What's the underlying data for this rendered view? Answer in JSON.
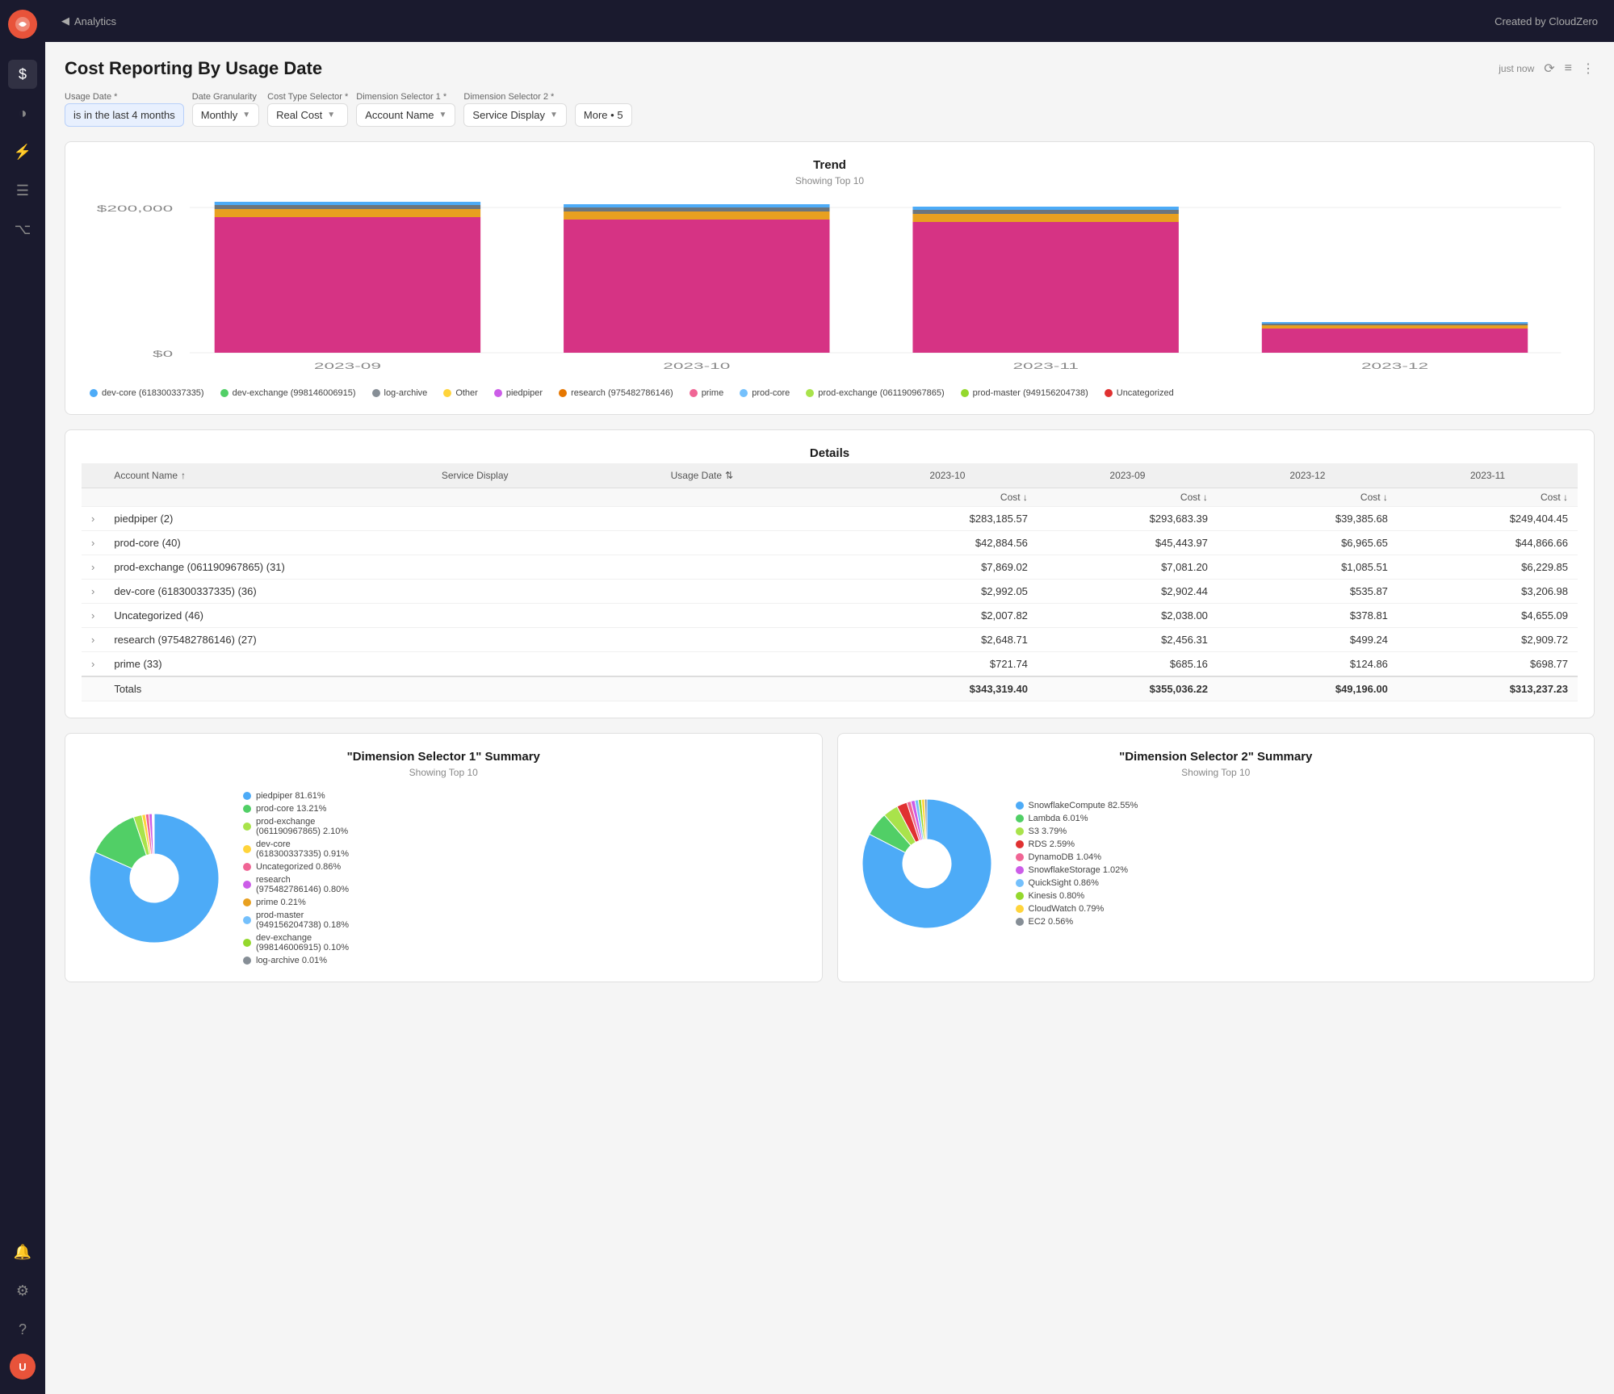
{
  "app": {
    "logo_text": "CZ",
    "nav_back": "◀",
    "nav_section": "Analytics",
    "created_by": "Created by CloudZero"
  },
  "sidebar": {
    "icons": [
      {
        "name": "dollar-icon",
        "symbol": "$",
        "active": true
      },
      {
        "name": "pie-chart-icon",
        "symbol": "◑",
        "active": false
      },
      {
        "name": "lightbulb-icon",
        "symbol": "💡",
        "active": false
      },
      {
        "name": "list-icon",
        "symbol": "≡",
        "active": false
      },
      {
        "name": "code-icon",
        "symbol": "⌥",
        "active": false
      },
      {
        "name": "bell-icon",
        "symbol": "🔔",
        "active": false
      },
      {
        "name": "gear-icon",
        "symbol": "⚙",
        "active": false
      },
      {
        "name": "help-icon",
        "symbol": "?",
        "active": false
      }
    ],
    "avatar_initials": "U"
  },
  "page": {
    "title": "Cost Reporting By Usage Date",
    "time_label": "just now",
    "filter_icon": "⟳",
    "menu_icon": "⋮"
  },
  "filters": {
    "usage_date_label": "Usage Date *",
    "usage_date_value": "is in the last 4 months",
    "granularity_label": "Date Granularity",
    "granularity_value": "Monthly",
    "cost_type_label": "Cost Type Selector *",
    "cost_type_value": "Real Cost",
    "dim1_label": "Dimension Selector 1 *",
    "dim1_value": "Account Name",
    "dim2_label": "Dimension Selector 2 *",
    "dim2_value": "Service Display",
    "more_label": "More • 5"
  },
  "trend": {
    "title": "Trend",
    "subtitle": "Showing Top 10",
    "y_labels": [
      "$200,000",
      "$0"
    ],
    "x_labels": [
      "2023-09",
      "2023-10",
      "2023-11",
      "2023-12"
    ],
    "bars": [
      {
        "period": "2023-09",
        "total_height": 95,
        "segments": [
          {
            "color": "#d63384",
            "pct": 88
          },
          {
            "color": "#e8a020",
            "pct": 6
          },
          {
            "color": "#6c757d",
            "pct": 3
          },
          {
            "color": "#adb5bd",
            "pct": 3
          }
        ]
      },
      {
        "period": "2023-10",
        "total_height": 92,
        "segments": [
          {
            "color": "#d63384",
            "pct": 88
          },
          {
            "color": "#e8a020",
            "pct": 6
          },
          {
            "color": "#6c757d",
            "pct": 3
          },
          {
            "color": "#adb5bd",
            "pct": 3
          }
        ]
      },
      {
        "period": "2023-11",
        "total_height": 90,
        "segments": [
          {
            "color": "#d63384",
            "pct": 88
          },
          {
            "color": "#e8a020",
            "pct": 6
          },
          {
            "color": "#6c757d",
            "pct": 3
          },
          {
            "color": "#adb5bd",
            "pct": 3
          }
        ]
      },
      {
        "period": "2023-12",
        "total_height": 20,
        "segments": [
          {
            "color": "#d63384",
            "pct": 70
          },
          {
            "color": "#e8a020",
            "pct": 15
          },
          {
            "color": "#6c757d",
            "pct": 10
          },
          {
            "color": "#adb5bd",
            "pct": 5
          }
        ]
      }
    ],
    "legend": [
      {
        "color": "#4dabf7",
        "label": "dev-core (618300337335)"
      },
      {
        "color": "#51cf66",
        "label": "dev-exchange (998146006915)"
      },
      {
        "color": "#868e96",
        "label": "log-archive"
      },
      {
        "color": "#ffd43b",
        "label": "Other"
      },
      {
        "color": "#cc5de8",
        "label": "piedpiper"
      },
      {
        "color": "#e67700",
        "label": "research (975482786146)"
      },
      {
        "color": "#f06595",
        "label": "prime"
      },
      {
        "color": "#74c0fc",
        "label": "prod-core"
      },
      {
        "color": "#a9e34b",
        "label": "prod-exchange (061190967865)"
      },
      {
        "color": "#94d82d",
        "label": "prod-master (949156204738)"
      },
      {
        "color": "#e03131",
        "label": "Uncategorized"
      }
    ]
  },
  "details": {
    "title": "Details",
    "columns": [
      {
        "label": "",
        "key": "expand"
      },
      {
        "label": "Account Name",
        "key": "account",
        "sortable": true,
        "sort_dir": "asc"
      },
      {
        "label": "Service Display",
        "key": "service",
        "sortable": false
      },
      {
        "label": "Usage Date",
        "key": "usage_date",
        "sortable": true,
        "sort_dir": "desc"
      },
      {
        "label": "2023-10",
        "key": "c1"
      },
      {
        "label": "2023-09",
        "key": "c2"
      },
      {
        "label": "2023-12",
        "key": "c3"
      },
      {
        "label": "2023-11",
        "key": "c4"
      }
    ],
    "col_headers_2": [
      "Cost ↓",
      "Cost ↓",
      "Cost ↓",
      "Cost ↓"
    ],
    "rows": [
      {
        "expand": "›",
        "account": "piedpiper  (2)",
        "c1": "$283,185.57",
        "c2": "$293,683.39",
        "c3": "$39,385.68",
        "c4": "$249,404.45"
      },
      {
        "expand": "›",
        "account": "prod-core  (40)",
        "c1": "$42,884.56",
        "c2": "$45,443.97",
        "c3": "$6,965.65",
        "c4": "$44,866.66"
      },
      {
        "expand": "›",
        "account": "prod-exchange (061190967865)  (31)",
        "c1": "$7,869.02",
        "c2": "$7,081.20",
        "c3": "$1,085.51",
        "c4": "$6,229.85"
      },
      {
        "expand": "›",
        "account": "dev-core (618300337335)  (36)",
        "c1": "$2,992.05",
        "c2": "$2,902.44",
        "c3": "$535.87",
        "c4": "$3,206.98"
      },
      {
        "expand": "›",
        "account": "Uncategorized  (46)",
        "c1": "$2,007.82",
        "c2": "$2,038.00",
        "c3": "$378.81",
        "c4": "$4,655.09"
      },
      {
        "expand": "›",
        "account": "research (975482786146)  (27)",
        "c1": "$2,648.71",
        "c2": "$2,456.31",
        "c3": "$499.24",
        "c4": "$2,909.72"
      },
      {
        "expand": "›",
        "account": "prime  (33)",
        "c1": "$721.74",
        "c2": "$685.16",
        "c3": "$124.86",
        "c4": "$698.77"
      }
    ],
    "totals": {
      "label": "Totals",
      "c1": "$343,319.40",
      "c2": "$355,036.22",
      "c3": "$49,196.00",
      "c4": "$313,237.23"
    }
  },
  "dim1_summary": {
    "title": "\"Dimension Selector 1\" Summary",
    "subtitle": "Showing Top 10",
    "items": [
      {
        "color": "#4dabf7",
        "label": "piedpiper 81.61%",
        "pct": 81.61
      },
      {
        "color": "#51cf66",
        "label": "prod-core 13.21%",
        "pct": 13.21
      },
      {
        "color": "#a9e34b",
        "label": "prod-exchange\n(061190967865) 2.10%",
        "pct": 2.1
      },
      {
        "color": "#ffd43b",
        "label": "dev-core\n(618300337335) 0.91%",
        "pct": 0.91
      },
      {
        "color": "#f06595",
        "label": "Uncategorized 0.86%",
        "pct": 0.86
      },
      {
        "color": "#cc5de8",
        "label": "research\n(975482786146) 0.80%",
        "pct": 0.8
      },
      {
        "color": "#e8a020",
        "label": "prime 0.21%",
        "pct": 0.21
      },
      {
        "color": "#74c0fc",
        "label": "prod-master\n(949156204738) 0.18%",
        "pct": 0.18
      },
      {
        "color": "#94d82d",
        "label": "dev-exchange\n(998146006915) 0.10%",
        "pct": 0.1
      },
      {
        "color": "#868e96",
        "label": "log-archive 0.01%",
        "pct": 0.01
      }
    ]
  },
  "dim2_summary": {
    "title": "\"Dimension Selector 2\" Summary",
    "subtitle": "Showing Top 10",
    "items": [
      {
        "color": "#4dabf7",
        "label": "SnowflakeCompute 82.55%",
        "pct": 82.55
      },
      {
        "color": "#51cf66",
        "label": "Lambda 6.01%",
        "pct": 6.01
      },
      {
        "color": "#a9e34b",
        "label": "S3 3.79%",
        "pct": 3.79
      },
      {
        "color": "#e03131",
        "label": "RDS 2.59%",
        "pct": 2.59
      },
      {
        "color": "#f06595",
        "label": "DynamoDB 1.04%",
        "pct": 1.04
      },
      {
        "color": "#cc5de8",
        "label": "SnowflakeStorage 1.02%",
        "pct": 1.02
      },
      {
        "color": "#74c0fc",
        "label": "QuickSight 0.86%",
        "pct": 0.86
      },
      {
        "color": "#94d82d",
        "label": "Kinesis 0.80%",
        "pct": 0.8
      },
      {
        "color": "#ffd43b",
        "label": "CloudWatch 0.79%",
        "pct": 0.79
      },
      {
        "color": "#868e96",
        "label": "EC2 0.56%",
        "pct": 0.56
      }
    ]
  }
}
